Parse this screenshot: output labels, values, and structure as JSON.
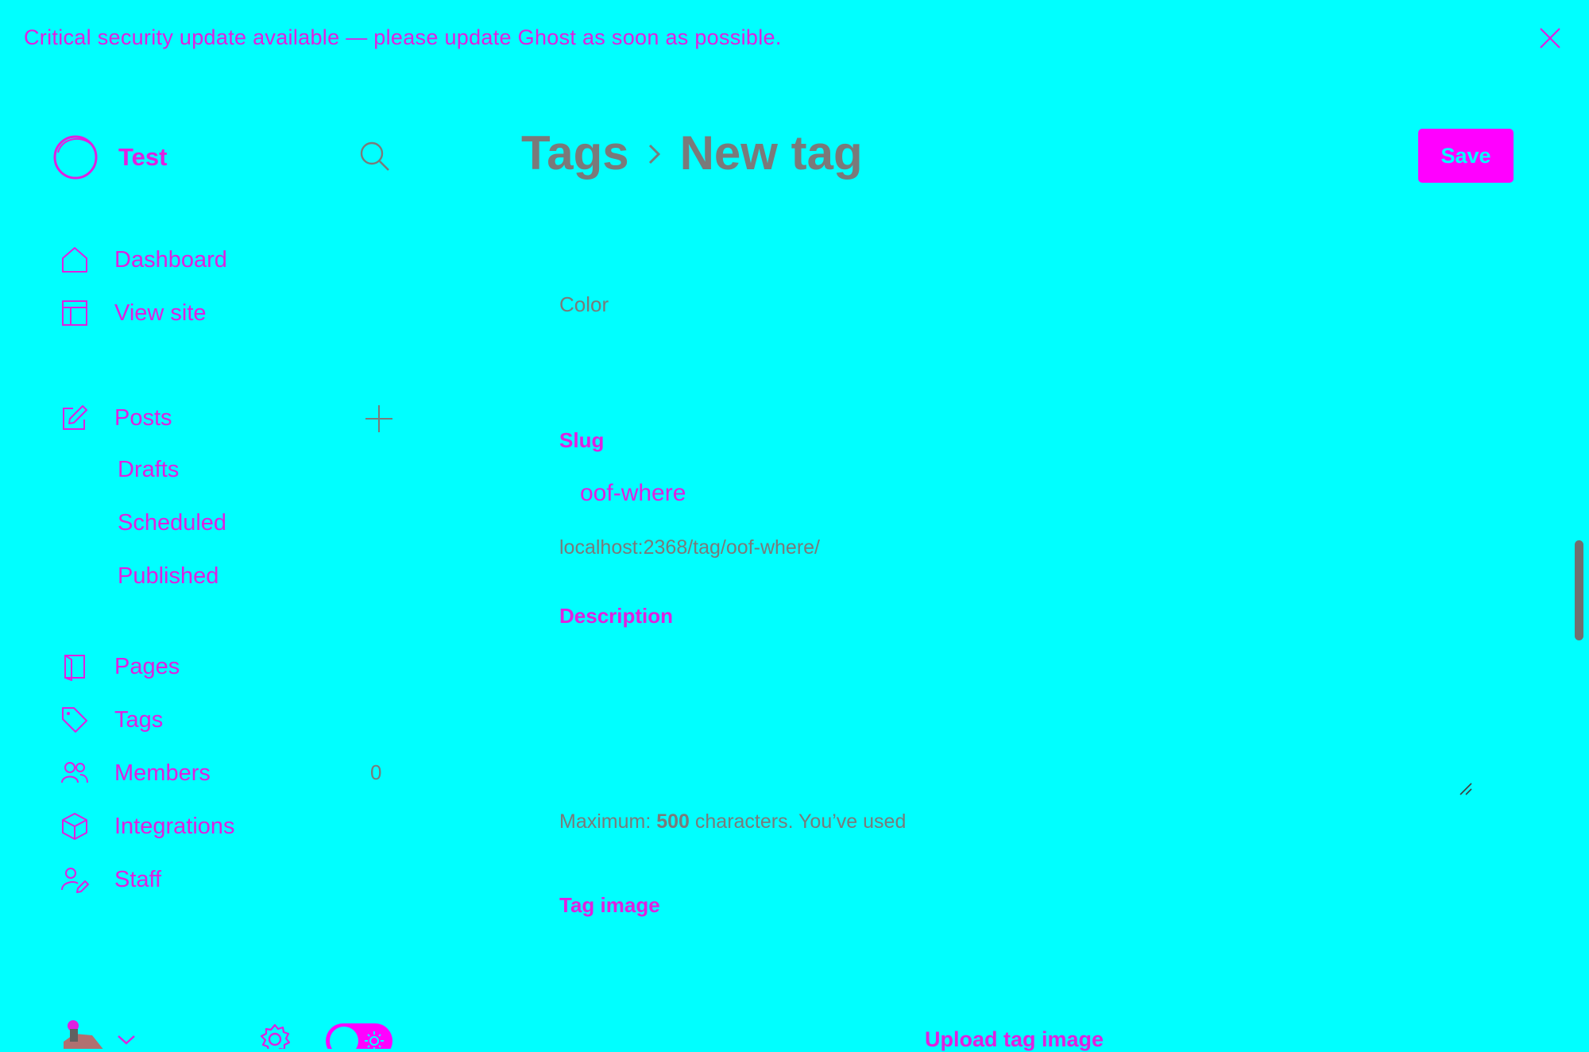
{
  "banner": {
    "message": "Critical security update available — please update Ghost as soon as possible."
  },
  "colors": {
    "background": "#00ffff",
    "accent": "#ff00ff",
    "text_accent": "#e020e0",
    "text_muted": "#7a7a7a"
  },
  "sidebar": {
    "site_title": "Test",
    "items": [
      {
        "label": "Dashboard",
        "icon": "home-icon"
      },
      {
        "label": "View site",
        "icon": "layout-icon"
      },
      {
        "label": "Posts",
        "icon": "edit-icon"
      },
      {
        "label": "Pages",
        "icon": "pages-icon"
      },
      {
        "label": "Tags",
        "icon": "tag-icon"
      },
      {
        "label": "Members",
        "icon": "members-icon"
      },
      {
        "label": "Integrations",
        "icon": "box-icon"
      },
      {
        "label": "Staff",
        "icon": "staff-icon"
      }
    ],
    "post_subitems": [
      "Drafts",
      "Scheduled",
      "Published"
    ],
    "members_count": "0"
  },
  "header": {
    "breadcrumb_parent": "Tags",
    "breadcrumb_current": "New tag",
    "save_label": "Save"
  },
  "form": {
    "color_label": "Color",
    "slug_label": "Slug",
    "slug_value": "oof-where",
    "slug_url": "localhost:2368/tag/oof-where/",
    "description_label": "Description",
    "description_value": "",
    "description_hint_prefix": "Maximum: ",
    "description_hint_max": "500",
    "description_hint_suffix": " characters. You’ve used",
    "tag_image_label": "Tag image",
    "upload_label": "Upload tag image"
  }
}
